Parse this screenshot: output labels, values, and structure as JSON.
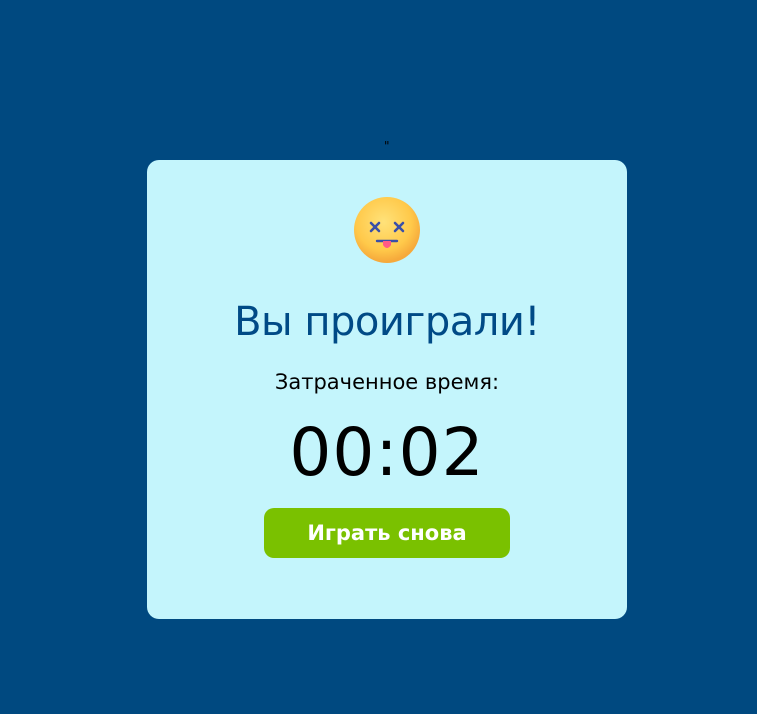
{
  "stray_mark": "\"",
  "modal": {
    "emoji_icon": "dizzy-face-icon",
    "title": "Вы проиграли!",
    "time_label": "Затраченное время:",
    "time_value": "00:02",
    "play_again_label": "Играть снова"
  },
  "colors": {
    "background": "#004980",
    "modal_background": "#c4f5fc",
    "title": "#004a86",
    "button": "#7ac100",
    "button_text": "#ffffff"
  }
}
